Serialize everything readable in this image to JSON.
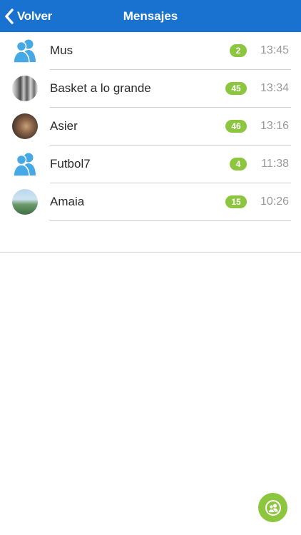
{
  "header": {
    "back_label": "Volver",
    "title": "Mensajes",
    "color": "#1a72d0"
  },
  "conversations": [
    {
      "name": "Mus",
      "unread": "2",
      "time": "13:45",
      "avatar": "group-icon"
    },
    {
      "name": "Basket a lo grande",
      "unread": "45",
      "time": "13:34",
      "avatar": "photo"
    },
    {
      "name": "Asier",
      "unread": "46",
      "time": "13:16",
      "avatar": "photo"
    },
    {
      "name": "Futbol7",
      "unread": "4",
      "time": "11:38",
      "avatar": "group-icon"
    },
    {
      "name": "Amaia",
      "unread": "15",
      "time": "10:26",
      "avatar": "photo"
    }
  ],
  "fab": {
    "icon": "new-group-chat-icon",
    "color": "#8cc63f"
  },
  "colors": {
    "badge": "#8cc63f",
    "group_icon": "#46a9e6"
  }
}
